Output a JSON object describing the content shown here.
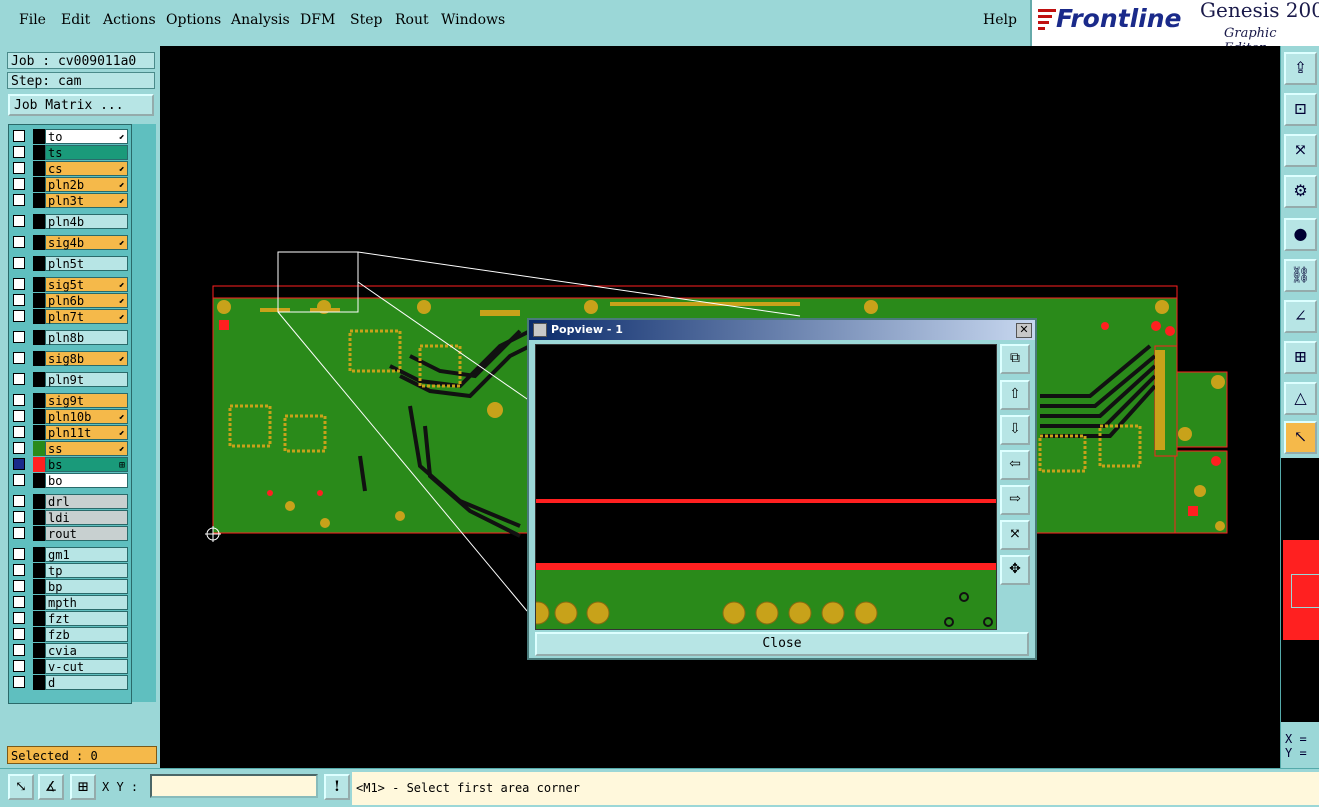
{
  "menubar": {
    "items": [
      "File",
      "Edit",
      "Actions",
      "Options",
      "Analysis",
      "DFM",
      "Step",
      "Rout",
      "Windows"
    ],
    "help": "Help"
  },
  "brand": {
    "logo_text": "Frontline",
    "product": "Genesis 200",
    "subtitle": "Graphic Editor"
  },
  "job": {
    "job_label": "Job : cv009011a0",
    "step_label": "Step: cam",
    "matrix_button": "Job Matrix ..."
  },
  "layers": [
    {
      "name": "to",
      "bg": "#ffffff",
      "mark": "⬋"
    },
    {
      "name": "ts",
      "bg": "#1a9a7a",
      "mark": ""
    },
    {
      "name": "cs",
      "bg": "#f5b94a",
      "mark": "⬋"
    },
    {
      "name": "pln2b",
      "bg": "#f5b94a",
      "mark": "⬋"
    },
    {
      "name": "pln3t",
      "bg": "#f5b94a",
      "mark": "⬋"
    },
    {
      "name": "pln4b",
      "bg": "#b7e5e5",
      "mark": ""
    },
    {
      "name": "sig4b",
      "bg": "#f5b94a",
      "mark": "⬋"
    },
    {
      "name": "pln5t",
      "bg": "#b7e5e5",
      "mark": ""
    },
    {
      "name": "sig5t",
      "bg": "#f5b94a",
      "mark": "⬋"
    },
    {
      "name": "pln6b",
      "bg": "#f5b94a",
      "mark": "⬋"
    },
    {
      "name": "pln7t",
      "bg": "#f5b94a",
      "mark": "⬋"
    },
    {
      "name": "pln8b",
      "bg": "#b7e5e5",
      "mark": ""
    },
    {
      "name": "sig8b",
      "bg": "#f5b94a",
      "mark": "⬋"
    },
    {
      "name": "pln9t",
      "bg": "#b7e5e5",
      "mark": ""
    },
    {
      "name": "sig9t",
      "bg": "#f5b94a",
      "mark": ""
    },
    {
      "name": "pln10b",
      "bg": "#f5b94a",
      "mark": "⬋"
    },
    {
      "name": "pln11t",
      "bg": "#f5b94a",
      "mark": "⬋"
    },
    {
      "name": "ss",
      "bg": "#f5b94a",
      "mark": "⬋"
    },
    {
      "name": "bs",
      "bg": "#1a9a7a",
      "mark": "⊞"
    },
    {
      "name": "bo",
      "bg": "#ffffff",
      "mark": ""
    },
    {
      "name": "drl",
      "bg": "#c8d0d0",
      "mark": ""
    },
    {
      "name": "ldi",
      "bg": "#c8d0d0",
      "mark": ""
    },
    {
      "name": "rout",
      "bg": "#c8d0d0",
      "mark": ""
    },
    {
      "name": "gm1",
      "bg": "#b7e5e5",
      "mark": ""
    },
    {
      "name": "tp",
      "bg": "#b7e5e5",
      "mark": ""
    },
    {
      "name": "bp",
      "bg": "#b7e5e5",
      "mark": ""
    },
    {
      "name": "mpth",
      "bg": "#b7e5e5",
      "mark": ""
    },
    {
      "name": "fzt",
      "bg": "#b7e5e5",
      "mark": ""
    },
    {
      "name": "fzb",
      "bg": "#b7e5e5",
      "mark": ""
    },
    {
      "name": "cvia",
      "bg": "#b7e5e5",
      "mark": ""
    },
    {
      "name": "v-cut",
      "bg": "#b7e5e5",
      "mark": ""
    },
    {
      "name": "d",
      "bg": "#b7e5e5",
      "mark": ""
    }
  ],
  "selected_label": "Selected : 0",
  "status": {
    "xy_label": "X Y :",
    "xy_value": "",
    "warn_button": "!",
    "message": "<M1> - Select first area corner"
  },
  "coords": {
    "x_label": "X =",
    "y_label": "Y ="
  },
  "popview": {
    "title": "Popview - 1",
    "close_button": "Close"
  },
  "colors": {
    "board_green": "#2a8a1a",
    "pad_gold": "#c8a21a",
    "outline_red": "#ff2020",
    "panel_cyan": "#9bd7d7"
  }
}
